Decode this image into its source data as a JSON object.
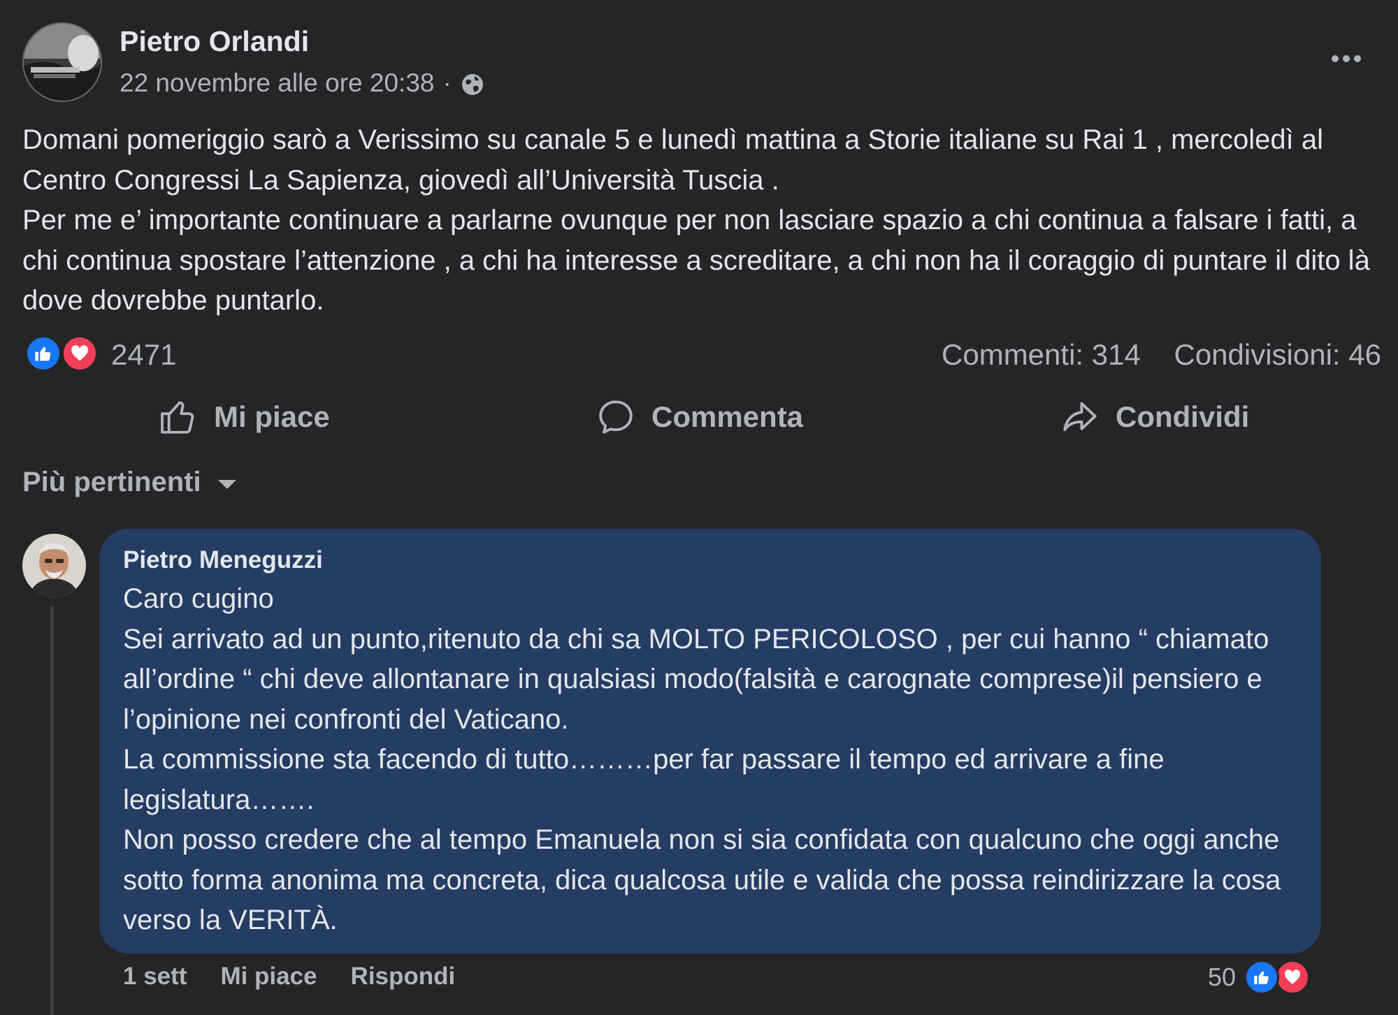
{
  "post": {
    "author": "Pietro Orlandi",
    "timestamp": "22 novembre alle ore 20:38",
    "separator": "·",
    "privacy_icon": "globe-icon",
    "paragraphs": [
      "Domani pomeriggio sarò a Verissimo su canale 5 e lunedì mattina a Storie italiane su Rai 1 , mercoledì al Centro Congressi La Sapienza, giovedì all’Università Tuscia .",
      "Per me e’ importante continuare a parlarne ovunque per non lasciare spazio a chi continua a falsare i fatti, a chi continua spostare l’attenzione , a chi ha interesse a screditare, a chi non ha il coraggio di puntare il dito là dove dovrebbe puntarlo."
    ]
  },
  "stats": {
    "reactions_count": "2471",
    "comments": "Commenti: 314",
    "shares": "Condivisioni: 46"
  },
  "actions": {
    "like": "Mi piace",
    "comment": "Commenta",
    "share": "Condividi"
  },
  "sort": {
    "label": "Più pertinenti"
  },
  "comment": {
    "author": "Pietro Meneguzzi",
    "lines": [
      "Caro cugino",
      "Sei arrivato ad un punto,ritenuto da chi sa MOLTO PERICOLOSO , per cui hanno “ chiamato all’ordine “ chi deve allontanare in qualsiasi modo(falsità e carognate comprese)il pensiero e l’opinione nei confronti del Vaticano.",
      "La commissione sta facendo di tutto………per far passare il tempo ed arrivare a fine legislatura…….",
      "Non posso credere che al tempo Emanuela non si sia confidata con qualcuno che oggi anche sotto forma anonima ma concreta, dica qualcosa utile e valida che possa reindirizzare la cosa verso la VERITÀ."
    ],
    "time": "1 sett",
    "like": "Mi piace",
    "reply": "Rispondi",
    "reactions_count": "50"
  },
  "colors": {
    "background": "#242526",
    "bubble": "#253c63",
    "like_blue": "#1877f2",
    "love_red": "#f33e58",
    "secondary_text": "#b0b3b8"
  }
}
